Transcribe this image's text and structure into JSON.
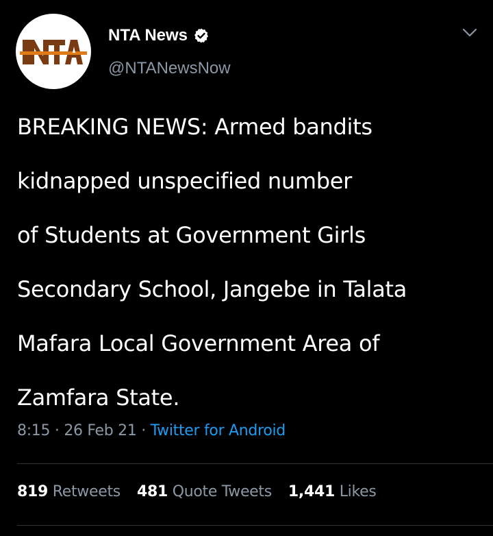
{
  "user": {
    "display_name": "NTA News",
    "handle": "@NTANewsNow",
    "avatar_logo_text": "NTA",
    "verified": true
  },
  "tweet": {
    "lines": [
      "BREAKING NEWS: Armed bandits",
      "kidnapped unspecified number",
      "of Students at Government Girls",
      "Secondary School, Jangebe in Talata",
      "Mafara Local Government Area of",
      "Zamfara State."
    ]
  },
  "meta": {
    "time": "8:15",
    "sep1": " · ",
    "date": "26 Feb 21",
    "sep2": " · ",
    "source": "Twitter for Android"
  },
  "stats": {
    "retweets_count": "819",
    "retweets_label": "Retweets",
    "quotes_count": "481",
    "quotes_label": "Quote Tweets",
    "likes_count": "1,441",
    "likes_label": "Likes"
  },
  "icons": {
    "verified": "verified-badge-icon",
    "more": "chevron-down-icon"
  },
  "colors": {
    "background": "#000000",
    "text": "#ffffff",
    "secondary": "#8b98a5",
    "link": "#1d9bf0",
    "logo_brown": "#7a3a12",
    "logo_orange": "#e07b1a"
  }
}
